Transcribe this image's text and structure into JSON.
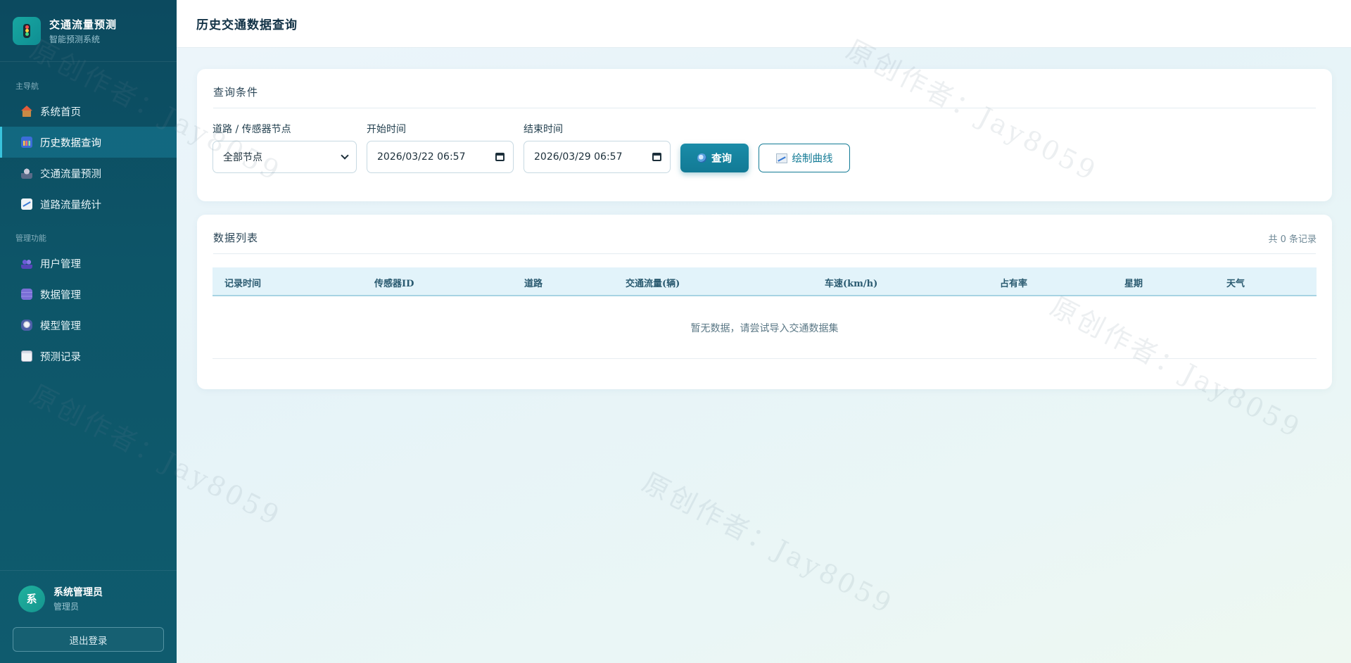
{
  "brand": {
    "title": "交通流量预测",
    "subtitle": "智能预测系统"
  },
  "sidebar": {
    "group_main": "主导航",
    "group_admin": "管理功能",
    "items_main": [
      {
        "label": "系统首页",
        "icon": "home-icon"
      },
      {
        "label": "历史数据查询",
        "icon": "bar-chart-icon",
        "active": true
      },
      {
        "label": "交通流量预测",
        "icon": "robot-icon"
      },
      {
        "label": "道路流量统计",
        "icon": "trend-chart-icon"
      }
    ],
    "items_admin": [
      {
        "label": "用户管理",
        "icon": "users-icon"
      },
      {
        "label": "数据管理",
        "icon": "database-icon"
      },
      {
        "label": "模型管理",
        "icon": "model-icon"
      },
      {
        "label": "预测记录",
        "icon": "record-icon"
      }
    ]
  },
  "user": {
    "avatar_text": "系",
    "name": "系统管理员",
    "role": "管理员",
    "logout": "退出登录"
  },
  "header": {
    "title": "历史交通数据查询"
  },
  "query": {
    "title": "查询条件",
    "node_label": "道路 / 传感器节点",
    "node_value": "全部节点",
    "start_label": "开始时间",
    "start_value": "2026/03/22 06:57",
    "end_label": "结束时间",
    "end_value": "2026/03/29 06:57",
    "search_button": "查询",
    "plot_button": "绘制曲线"
  },
  "list": {
    "title": "数据列表",
    "count": "共 0 条记录",
    "columns": [
      "记录时间",
      "传感器ID",
      "道路",
      "交通流量(辆)",
      "车速(km/h)",
      "占有率",
      "星期",
      "天气"
    ],
    "empty_text": "暂无数据，请尝试导入交通数据集"
  },
  "watermark": "原创作者：Jay8059",
  "colors": {
    "accent": "#127a95",
    "sidebar": "#0d5568",
    "active_nav": "#39c3dd"
  }
}
